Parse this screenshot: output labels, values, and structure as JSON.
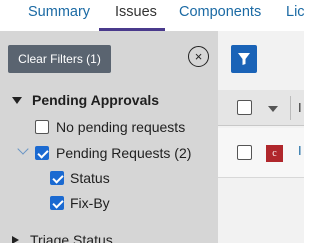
{
  "tabs": [
    {
      "label": "Summary"
    },
    {
      "label": "Issues"
    },
    {
      "label": "Components"
    },
    {
      "label": "Lic"
    }
  ],
  "active_tab": "Issues",
  "sidebar": {
    "clear_filters": "Clear Filters (1)",
    "close_icon": "×",
    "sections": [
      {
        "title": "Pending Approvals",
        "expanded": true,
        "items": [
          {
            "label": "No pending requests",
            "checked": false
          },
          {
            "label": "Pending Requests (2)",
            "checked": true,
            "children": [
              {
                "label": "Status",
                "checked": true
              },
              {
                "label": "Fix-By",
                "checked": true
              }
            ]
          }
        ]
      },
      {
        "title": "Triage Status",
        "expanded": false
      }
    ]
  },
  "main": {
    "filter_icon": "funnel-icon",
    "header_col_initial": "I",
    "row": {
      "type_badge": "c",
      "link_initial": "I"
    }
  },
  "colors": {
    "accent": "#1a63b7",
    "tab_link": "#1b6aa4",
    "active_underline": "#4a3a8c",
    "badge_red": "#b0272c",
    "sidebar_bg": "#d6d6d6"
  }
}
